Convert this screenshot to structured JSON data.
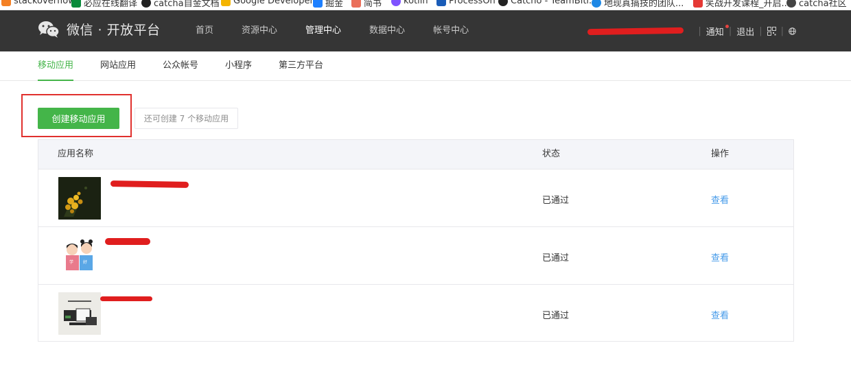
{
  "bookmarks": [
    {
      "label": "stackoverflow",
      "color": "#f48024"
    },
    {
      "label": "必应在线翻译",
      "color": "#0a8a3b"
    },
    {
      "label": "catcha自金文档",
      "color": "#222222"
    },
    {
      "label": "Google Developers",
      "color": "#f4b400"
    },
    {
      "label": "掘金",
      "color": "#1e80ff"
    },
    {
      "label": "简书",
      "color": "#ea6f5a"
    },
    {
      "label": "kotlin",
      "color": "#7f52ff"
    },
    {
      "label": "ProcessOn",
      "color": "#1a5cb8"
    },
    {
      "label": "Catcho - TeamBiti...",
      "color": "#222222"
    },
    {
      "label": "地现真搞技的团队...",
      "color": "#1e88e5"
    },
    {
      "label": "笑战开发课程_开启...",
      "color": "#e53935"
    },
    {
      "label": "catcha社区",
      "color": "#444444"
    }
  ],
  "header": {
    "brand": "微信 · 开放平台",
    "nav": [
      "首页",
      "资源中心",
      "管理中心",
      "数据中心",
      "帐号中心"
    ],
    "active_nav": "管理中心",
    "notice": "通知",
    "logout": "退出",
    "sep": "|"
  },
  "subtabs": {
    "items": [
      "移动应用",
      "网站应用",
      "公众帐号",
      "小程序",
      "第三方平台"
    ],
    "active": "移动应用"
  },
  "actions": {
    "create_label": "创建移动应用",
    "quota_text": "还可创建 7 个移动应用"
  },
  "table": {
    "columns": [
      "应用名称",
      "状态",
      "操作"
    ],
    "rows": [
      {
        "status": "已通过",
        "action": "查看"
      },
      {
        "status": "已通过",
        "action": "查看"
      },
      {
        "status": "已通过",
        "action": "查看"
      }
    ]
  },
  "colors": {
    "accent_green": "#44b549",
    "link_blue": "#459ae9",
    "header_bg": "#353535",
    "redaction_red": "#e01e1e",
    "highlight_red": "#e0302d"
  },
  "icons": [
    "wechat-logo-icon",
    "qrcode-icon",
    "globe-icon"
  ]
}
